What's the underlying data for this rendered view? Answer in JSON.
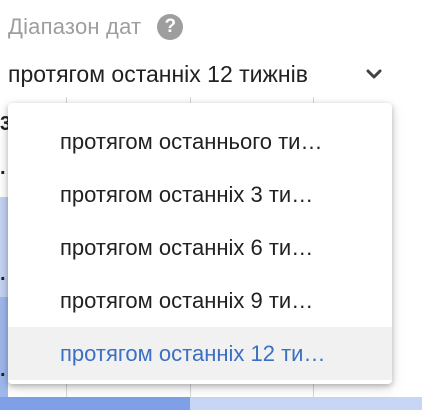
{
  "field": {
    "label": "Діапазон дат",
    "help_icon": "question-circle-icon",
    "selected_value": "протягом останніх 12 тижнів",
    "dropdown_icon": "chevron-down-icon"
  },
  "menu": {
    "items": [
      {
        "label": "протягом останнього ти…"
      },
      {
        "label": "протягом останніх 3 ти…"
      },
      {
        "label": "протягом останніх 6 ти…"
      },
      {
        "label": "протягом останніх 9 ти…"
      },
      {
        "label": "протягом останніх 12 ти…"
      }
    ],
    "selected_index": 4
  },
  "colors": {
    "label": "#9e9e9e",
    "selected_text": "#3b6fc4",
    "selected_bg": "#f1f1f1"
  }
}
